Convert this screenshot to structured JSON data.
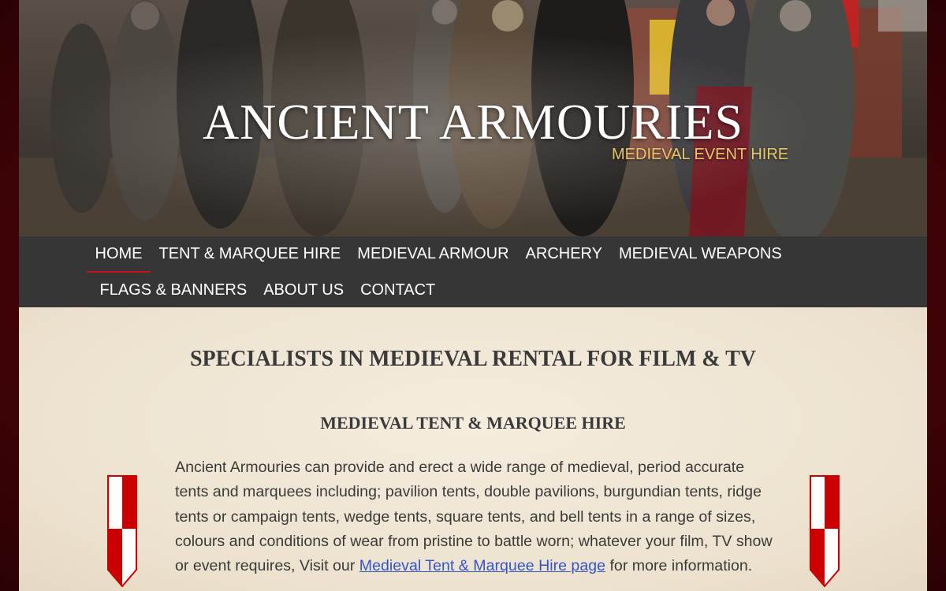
{
  "site": {
    "title": "ANCIENT ARMOURIES",
    "tagline": "MEDIEVAL EVENT HIRE"
  },
  "nav": {
    "row1": [
      {
        "label": "HOME",
        "active": true
      },
      {
        "label": "TENT & MARQUEE HIRE"
      },
      {
        "label": "MEDIEVAL ARMOUR"
      },
      {
        "label": "ARCHERY"
      },
      {
        "label": "MEDIEVAL WEAPONS"
      }
    ],
    "row2": [
      {
        "label": "FLAGS & BANNERS"
      },
      {
        "label": "ABOUT US"
      },
      {
        "label": "CONTACT"
      }
    ]
  },
  "content": {
    "heading": "SPECIALISTS IN MEDIEVAL RENTAL FOR FILM & TV",
    "subheading": "MEDIEVAL TENT & MARQUEE HIRE",
    "paragraph_text": "Ancient Armouries can provide and erect a wide range of medieval, period accurate tents and marquees including; pavilion tents, double pavilions, burgundian tents, ridge tents or campaign tents, wedge tents, square tents, and bell tents in a range of sizes, colours and conditions of wear from pristine to battle worn; whatever your film, TV show or event requires, Visit our ",
    "paragraph_link": "Medieval Tent & Marquee Hire page",
    "paragraph_end": " for more information."
  },
  "colors": {
    "background": "#4a0508",
    "nav_bg": "#363636",
    "nav_active_underline": "#c8101a",
    "tagline": "#e8c66a",
    "link": "#3355cc",
    "shield_red": "#cc0000"
  },
  "icons": {
    "left_shield": "heraldic-shield-icon",
    "right_shield": "heraldic-shield-icon"
  }
}
